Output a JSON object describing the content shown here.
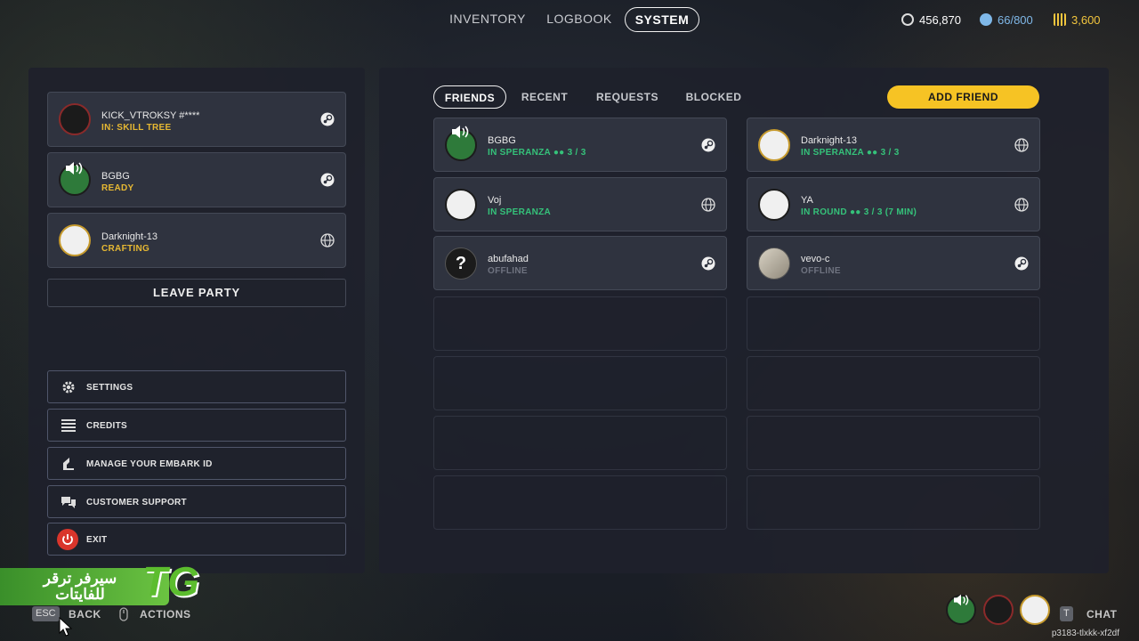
{
  "nav": {
    "tabs": [
      "INVENTORY",
      "LOGBOOK",
      "SYSTEM"
    ],
    "active": "SYSTEM"
  },
  "currencies": [
    {
      "icon": "coin-icon",
      "value": "456,870",
      "color": "#ffffff"
    },
    {
      "icon": "token-icon",
      "value": "66/800",
      "color": "#7fb8e8"
    },
    {
      "icon": "raider-token-icon",
      "value": "3,600",
      "color": "#f2c53d"
    }
  ],
  "party": [
    {
      "name": "KICK_VTROKSY #****",
      "status": "IN: SKILL TREE",
      "platform": "steam-icon"
    },
    {
      "name": "BGBG",
      "status": "READY",
      "platform": "steam-icon"
    },
    {
      "name": "Darknight-13",
      "status": "CRAFTING",
      "platform": "globe-icon"
    }
  ],
  "leave_party": "LEAVE PARTY",
  "menu": [
    {
      "label": "SETTINGS",
      "icon": "gear-icon"
    },
    {
      "label": "CREDITS",
      "icon": "list-icon"
    },
    {
      "label": "MANAGE YOUR EMBARK ID",
      "icon": "id-icon"
    },
    {
      "label": "CUSTOMER SUPPORT",
      "icon": "chat-icon"
    },
    {
      "label": "EXIT",
      "icon": "power-icon"
    }
  ],
  "friend_tabs": [
    "FRIENDS",
    "RECENT",
    "REQUESTS",
    "BLOCKED"
  ],
  "add_friend": "ADD FRIEND",
  "friends": [
    {
      "name": "BGBG",
      "status": "IN SPERANZA",
      "count": "3 / 3",
      "platform": "steam-icon"
    },
    {
      "name": "Darknight-13",
      "status": "IN SPERANZA",
      "count": "3 / 3",
      "platform": "globe-icon"
    },
    {
      "name": "Voj",
      "status": "IN SPERANZA",
      "count": "",
      "platform": "globe-icon"
    },
    {
      "name": "YA",
      "status": "IN ROUND",
      "count": "3 / 3 (7 MIN)",
      "platform": "globe-icon"
    },
    {
      "name": "abufahad",
      "status": "OFFLINE",
      "count": "",
      "platform": "steam-icon"
    },
    {
      "name": "vevo-c",
      "status": "OFFLINE",
      "count": "",
      "platform": "steam-icon"
    }
  ],
  "watermark": {
    "text": "سيرفر ترقر للفايتات",
    "logo": "TG"
  },
  "bottom": {
    "esc_key": "ESC",
    "back": "BACK",
    "actions": "ACTIONS",
    "t_key": "T",
    "chat": "CHAT",
    "code": "p3183-tlxkk-xf2df"
  },
  "colors": {
    "accent": "#f6c324",
    "online": "#35c27a",
    "status_yellow": "#e6b833",
    "offline": "#6f7380"
  }
}
